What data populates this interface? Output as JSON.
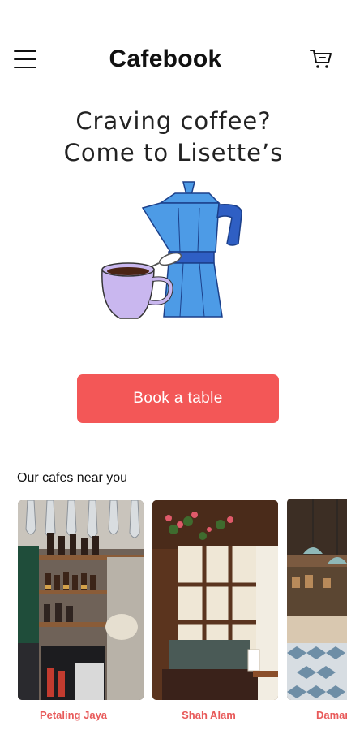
{
  "header": {
    "title": "Cafebook"
  },
  "hero": {
    "line1": "Craving coffee?",
    "line2": "Come to Lisette’s"
  },
  "cta": {
    "label": "Book a table"
  },
  "section": {
    "title": "Our cafes near you"
  },
  "cafes": [
    {
      "name": "Petaling Jaya"
    },
    {
      "name": "Shah Alam"
    },
    {
      "name": "Damar"
    }
  ],
  "icons": {
    "menu": "hamburger-menu-icon",
    "cart": "shopping-cart-icon"
  },
  "colors": {
    "accent": "#f35757",
    "label": "#e85a5a",
    "pot": "#4d9be6",
    "cup": "#c9b7ef"
  }
}
